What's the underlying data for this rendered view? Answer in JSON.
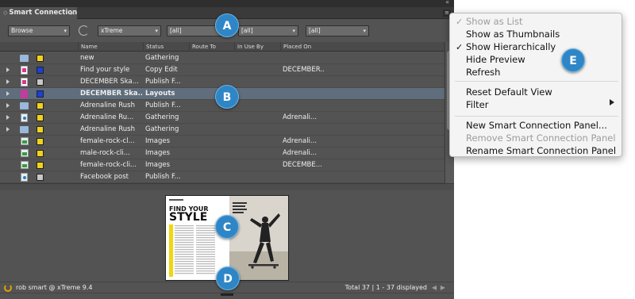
{
  "panel": {
    "tab_title": "Smart Connection",
    "status_user": "rob smart @ xTreme 9.4",
    "status_total": "Total 37 | 1 - 37 displayed"
  },
  "filters": {
    "mode": "Browse",
    "brand": "xTreme",
    "filter1": "[all]",
    "filter2": "[all]",
    "filter3": "[all]"
  },
  "columns": [
    "Name",
    "Status",
    "Route To",
    "In Use By",
    "Placed On"
  ],
  "rows": [
    {
      "icon": "folder-icon",
      "expandable": false,
      "color": "#f2d21b",
      "name": "new",
      "status": "Gathering",
      "route": "",
      "inuse": "",
      "placed": ""
    },
    {
      "icon": "indesign-icon",
      "expandable": true,
      "color": "#1c3fd6",
      "name": "Find your style",
      "status": "Copy Edit",
      "route": "",
      "inuse": "",
      "placed": "DECEMBER..."
    },
    {
      "icon": "indesign-icon",
      "expandable": true,
      "color": "#c8c8c8",
      "name": "DECEMBER Ska...",
      "status": "Publish F...",
      "route": "",
      "inuse": "",
      "placed": ""
    },
    {
      "icon": "layout-icon",
      "expandable": true,
      "color": "#1c3fd6",
      "name": "DECEMBER Ska...",
      "status": "Layouts",
      "route": "",
      "inuse": "",
      "placed": "",
      "selected": true
    },
    {
      "icon": "folder-icon",
      "expandable": true,
      "color": "#f2d21b",
      "name": "Adrenaline Rush",
      "status": "Publish F...",
      "route": "",
      "inuse": "",
      "placed": ""
    },
    {
      "icon": "incopy-icon",
      "expandable": true,
      "color": "#f2d21b",
      "name": "Adrenaline Ru...",
      "status": "Gathering",
      "route": "",
      "inuse": "",
      "placed": "Adrenali..."
    },
    {
      "icon": "folder-icon",
      "expandable": true,
      "color": "#f2d21b",
      "name": "Adrenaline Rush",
      "status": "Gathering",
      "route": "",
      "inuse": "",
      "placed": ""
    },
    {
      "icon": "image-icon",
      "expandable": false,
      "color": "#f2d21b",
      "name": "female-rock-cl...",
      "status": "Images",
      "route": "",
      "inuse": "",
      "placed": "Adrenali..."
    },
    {
      "icon": "image-icon",
      "expandable": false,
      "color": "#f2d21b",
      "name": "male-rock-cli...",
      "status": "Images",
      "route": "",
      "inuse": "",
      "placed": "Adrenali..."
    },
    {
      "icon": "image-icon",
      "expandable": false,
      "color": "#f2d21b",
      "name": "female-rock-cli...",
      "status": "Images",
      "route": "",
      "inuse": "",
      "placed": "DECEMBE..."
    },
    {
      "icon": "incopy-icon",
      "expandable": false,
      "color": "#c8c8c8",
      "name": "Facebook post",
      "status": "Publish F...",
      "route": "",
      "inuse": "",
      "placed": ""
    }
  ],
  "preview": {
    "headline_1": "FIND YOUR",
    "headline_2": "STYLE"
  },
  "callouts": [
    "A",
    "B",
    "C",
    "D",
    "E"
  ],
  "menu": {
    "items": [
      {
        "label": "Show as List",
        "checked": true,
        "disabled": true
      },
      {
        "label": "Show as Thumbnails",
        "checked": false,
        "disabled": false
      },
      {
        "label": "Show Hierarchically",
        "checked": true,
        "disabled": false
      },
      {
        "label": "Hide Preview",
        "checked": false,
        "disabled": false
      },
      {
        "label": "Refresh",
        "checked": false,
        "disabled": false
      },
      {
        "label": "Reset Default View",
        "checked": false,
        "disabled": false
      },
      {
        "label": "Filter",
        "checked": false,
        "disabled": false,
        "submenu": true
      },
      {
        "label": "New Smart Connection Panel...",
        "checked": false,
        "disabled": false
      },
      {
        "label": "Remove Smart Connection Panel",
        "checked": false,
        "disabled": true
      },
      {
        "label": "Rename Smart Connection Panel",
        "checked": false,
        "disabled": false
      }
    ]
  },
  "colors": {
    "accent_badge": "#2f86c7",
    "selected_row": "#5f6d7c",
    "panel_bg": "#535353"
  }
}
